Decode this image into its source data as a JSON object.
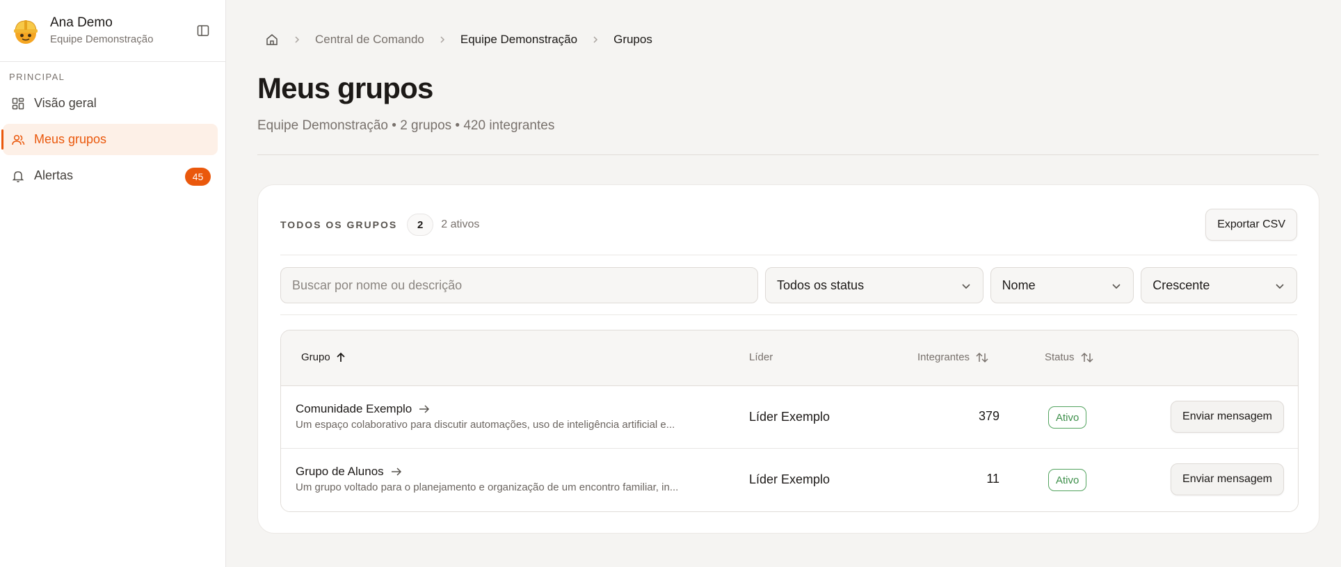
{
  "user": {
    "name": "Ana Demo",
    "team": "Equipe Demonstração"
  },
  "sidebar": {
    "section_label": "PRINCIPAL",
    "items": [
      {
        "label": "Visão geral",
        "icon": "grid-icon",
        "active": false
      },
      {
        "label": "Meus grupos",
        "icon": "users-icon",
        "active": true
      },
      {
        "label": "Alertas",
        "icon": "bell-icon",
        "active": false,
        "badge": "45"
      }
    ]
  },
  "breadcrumb": {
    "items": [
      "Central de Comando",
      "Equipe Demonstração",
      "Grupos"
    ]
  },
  "page": {
    "title": "Meus grupos",
    "subtitle": "Equipe Demonstração • 2 grupos • 420 integrantes"
  },
  "card": {
    "label": "TODOS OS GRUPOS",
    "count": "2",
    "active_text": "2 ativos",
    "export_label": "Exportar CSV"
  },
  "filters": {
    "search_placeholder": "Buscar por nome ou descrição",
    "status_value": "Todos os status",
    "sort_field_value": "Nome",
    "sort_order_value": "Crescente"
  },
  "table": {
    "columns": {
      "group": "Grupo",
      "leader": "Líder",
      "members": "Integrantes",
      "status": "Status"
    },
    "rows": [
      {
        "name": "Comunidade Exemplo",
        "description": "Um espaço colaborativo para discutir automações, uso de inteligência artificial e...",
        "leader": "Líder Exemplo",
        "members": "379",
        "status": "Ativo",
        "action": "Enviar mensagem"
      },
      {
        "name": "Grupo de Alunos",
        "description": "Um grupo voltado para o planejamento e organização de um encontro familiar, in...",
        "leader": "Líder Exemplo",
        "members": "11",
        "status": "Ativo",
        "action": "Enviar mensagem"
      }
    ]
  },
  "colors": {
    "accent": "#ea580c",
    "active_nav_bg": "#fdf0e7",
    "status_green": "#3d8f4a",
    "background": "#f5f4f2"
  }
}
